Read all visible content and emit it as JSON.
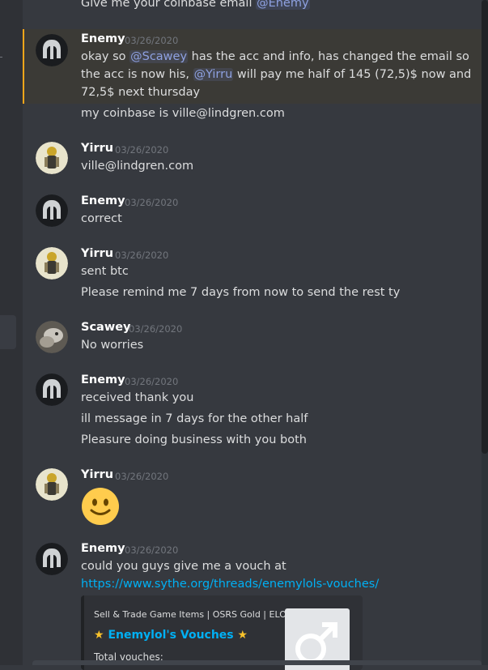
{
  "top_line": {
    "text": "Give me your coinbase email ",
    "mention": "@Enemy"
  },
  "messages": [
    {
      "user": "Enemy",
      "timestamp": "03/26/2020",
      "line1_pre": "okay so ",
      "mention1": "@Scawey",
      "line1_post": " has the acc and info, has changed the email so",
      "line2_pre": "the acc is now his, ",
      "mention2": "@Yirru",
      "line2_post": " will pay me half of 145 (72,5)$ now and",
      "line3": "72,5$ next thursday",
      "line4": "my coinbase is ville@lindgren.com"
    },
    {
      "user": "Yirru",
      "timestamp": "03/26/2020",
      "lines": [
        "ville@lindgren.com"
      ]
    },
    {
      "user": "Enemy",
      "timestamp": "03/26/2020",
      "lines": [
        "correct"
      ]
    },
    {
      "user": "Yirru",
      "timestamp": "03/26/2020",
      "lines": [
        "sent btc",
        "Please remind me 7 days from now to send the rest ty"
      ]
    },
    {
      "user": "Scawey",
      "timestamp": "03/26/2020",
      "lines": [
        "No worries"
      ]
    },
    {
      "user": "Enemy",
      "timestamp": "03/26/2020",
      "lines": [
        "received thank you",
        "ill message in 7 days for the other half",
        "Pleasure doing business with you both"
      ]
    },
    {
      "user": "Yirru",
      "timestamp": "03/26/2020",
      "emoji": "slightly-smiling-face"
    },
    {
      "user": "Enemy",
      "timestamp": "03/26/2020",
      "lines": [
        "could you guys give me a vouch at"
      ],
      "link": "https://www.sythe.org/threads/enemylols-vouches/"
    }
  ],
  "embed": {
    "provider": "Sell & Trade Game Items | OSRS Gold | ELO",
    "star": "★",
    "title": "Enemylol's Vouches",
    "description": "Total vouches:"
  },
  "colors": {
    "mention": "#8ea1e1",
    "link": "#00b0f4",
    "highlight_border": "#faa61a",
    "background": "#36393f"
  }
}
